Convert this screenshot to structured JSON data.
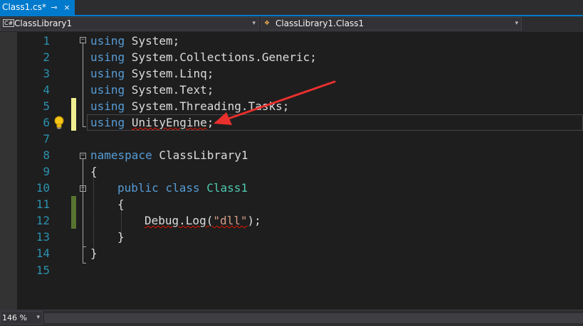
{
  "tab": {
    "title": "Class1.cs*",
    "pin_icon": "pin-icon",
    "close_icon": "close-icon",
    "pin_glyph": "⊸",
    "close_glyph": "×"
  },
  "navbar": {
    "project_combo": {
      "icon": "csharp-project-icon",
      "icon_text": "C#",
      "value": "ClassLibrary1"
    },
    "type_combo": {
      "icon": "class-icon",
      "value": "ClassLibrary1.Class1"
    },
    "dropdown_glyph": "▾"
  },
  "editor": {
    "line_numbers": [
      "1",
      "2",
      "3",
      "4",
      "5",
      "6",
      "7",
      "8",
      "9",
      "10",
      "11",
      "12",
      "13",
      "14",
      "15"
    ],
    "lines": {
      "l1": {
        "kw": "using",
        "rest": " System;"
      },
      "l2": {
        "kw": "using",
        "rest": " System.Collections.Generic;"
      },
      "l3": {
        "kw": "using",
        "rest": " System.Linq;"
      },
      "l4": {
        "kw": "using",
        "rest": " System.Text;"
      },
      "l5": {
        "kw": "using",
        "rest": " System.Threading.Tasks;"
      },
      "l6": {
        "kw": "using",
        "space": " ",
        "squiggle": "UnityEngine",
        "rest": ";"
      },
      "l8": {
        "kw": "namespace",
        "rest": " ClassLibrary1"
      },
      "l9": {
        "text": "{"
      },
      "l10": {
        "kw1": "public",
        "kw2": "class",
        "type": "Class1"
      },
      "l11": {
        "text": "{"
      },
      "l12": {
        "squiggle": "Debug.Log(",
        "str": "\"dll\"",
        "rest": ");"
      },
      "l13": {
        "text": "}"
      },
      "l14": {
        "text": "}"
      }
    },
    "lightbulb_icon": "lightbulb-icon",
    "annotation_arrow": "red-arrow"
  },
  "colors": {
    "accent": "#007acc",
    "keyword": "#569cd6",
    "type": "#4ec9b0",
    "string": "#d69d85",
    "line_number": "#2b91af",
    "unsaved_change": "#efef91",
    "saved_change": "#577430",
    "arrow": "#e8302d"
  },
  "statusbar": {
    "zoom": "146 %"
  }
}
